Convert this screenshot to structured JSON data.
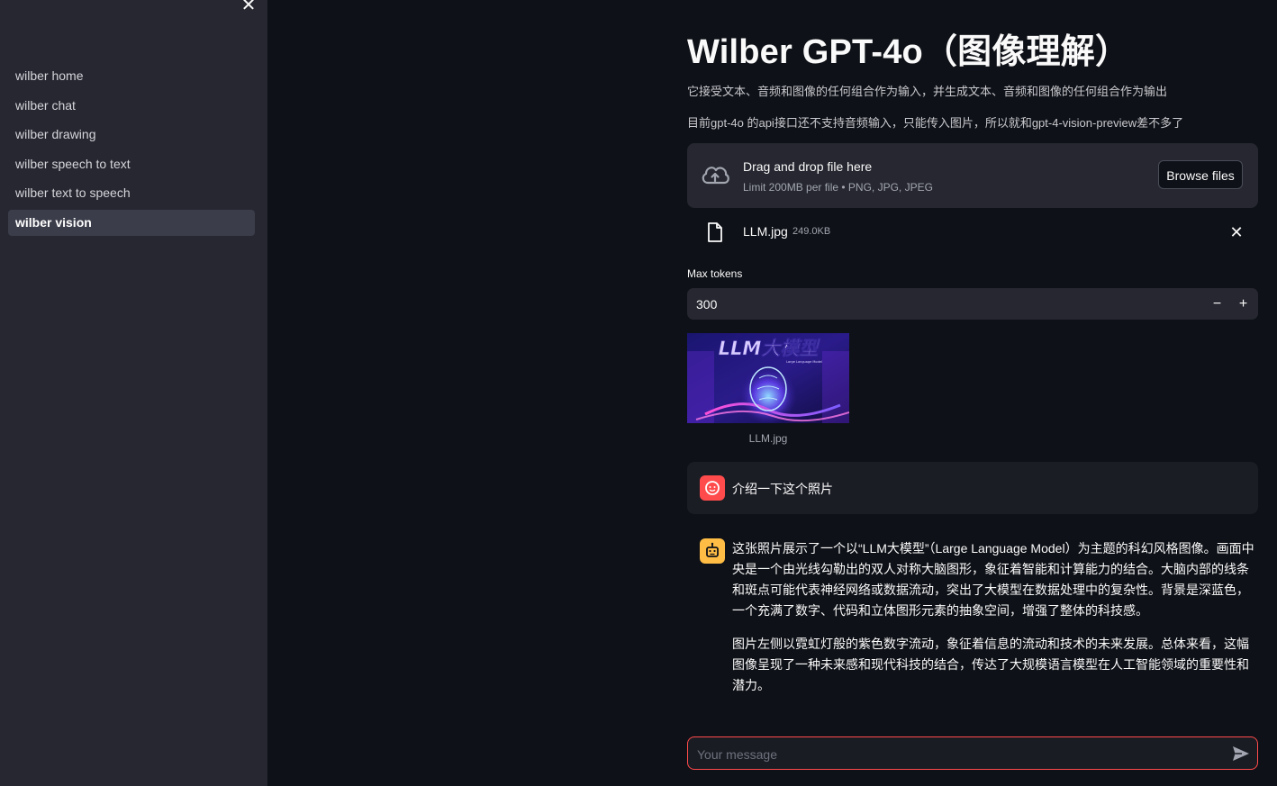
{
  "sidebar": {
    "close_label": "✕",
    "items": [
      {
        "label": "wilber home"
      },
      {
        "label": "wilber chat"
      },
      {
        "label": "wilber drawing"
      },
      {
        "label": "wilber speech to text"
      },
      {
        "label": "wilber text to speech"
      },
      {
        "label": "wilber vision",
        "active": true
      }
    ]
  },
  "main": {
    "title": "Wilber GPT-4o（图像理解）",
    "subtitle1": "它接受文本、音频和图像的任何组合作为输入，并生成文本、音频和图像的任何组合作为输出",
    "subtitle2": "目前gpt-4o 的api接口还不支持音频输入，只能传入图片，所以就和gpt-4-vision-preview差不多了"
  },
  "uploader": {
    "title": "Drag and drop file here",
    "limit": "Limit 200MB per file • PNG, JPG, JPEG",
    "browse_label": "Browse files",
    "icon": "cloud-upload-icon"
  },
  "file": {
    "name": "LLM.jpg",
    "size": "249.0KB",
    "icon": "file-icon",
    "remove_label": "✕"
  },
  "max_tokens": {
    "label": "Max tokens",
    "value": "300",
    "minus": "−",
    "plus": "+"
  },
  "preview": {
    "caption": "LLM.jpg",
    "image_text": "LLM大模型",
    "image_subtext": "Large Language Model"
  },
  "chat": {
    "user_message": "介绍一下这个照片",
    "bot_paragraphs": [
      "这张照片展示了一个以“LLM大模型”（Large Language Model）为主题的科幻风格图像。画面中央是一个由光线勾勒出的双人对称大脑图形，象征着智能和计算能力的结合。大脑内部的线条和斑点可能代表神经网络或数据流动，突出了大模型在数据处理中的复杂性。背景是深蓝色，一个充满了数字、代码和立体图形元素的抽象空间，增强了整体的科技感。",
      "图片左侧以霓虹灯般的紫色数字流动，象征着信息的流动和技术的未来发展。总体来看，这幅图像呈现了一种未来感和现代科技的结合，传达了大规模语言模型在人工智能领域的重要性和潜力。"
    ],
    "input_placeholder": "Your message"
  },
  "colors": {
    "background": "#0e1117",
    "sidebar": "#262730",
    "accent": "#ff4b4b",
    "bot_avatar": "#ffbd45"
  }
}
